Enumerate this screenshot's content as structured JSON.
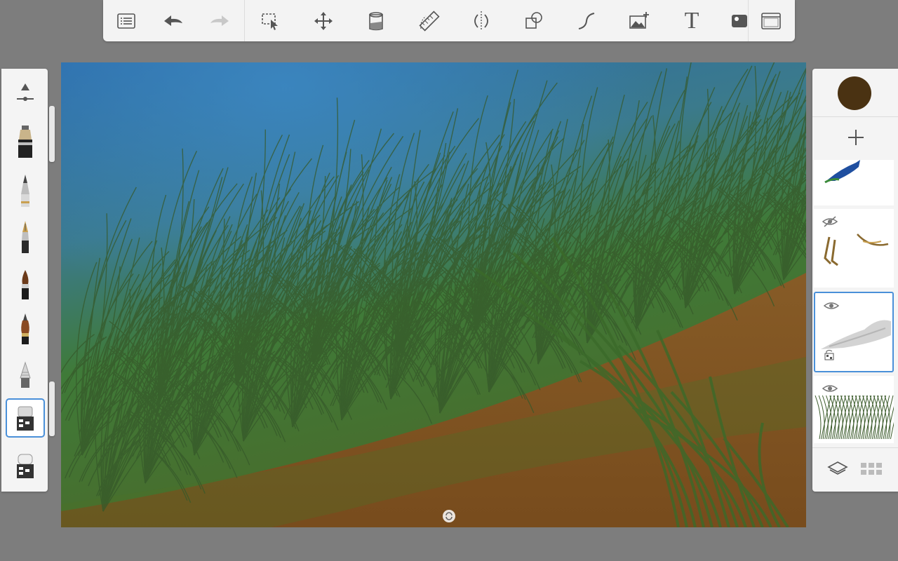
{
  "app": {
    "toolbar": {
      "tools": [
        {
          "name": "layers-menu",
          "icon": "list-icon"
        },
        {
          "name": "undo",
          "icon": "undo-icon"
        },
        {
          "name": "redo",
          "icon": "redo-icon"
        },
        {
          "name": "selection",
          "icon": "selection-icon"
        },
        {
          "name": "transform",
          "icon": "move-icon"
        },
        {
          "name": "fill",
          "icon": "bucket-icon"
        },
        {
          "name": "ruler",
          "icon": "ruler-icon"
        },
        {
          "name": "symmetry",
          "icon": "symmetry-icon"
        },
        {
          "name": "shapes",
          "icon": "shapes-icon"
        },
        {
          "name": "curve",
          "icon": "curve-icon"
        },
        {
          "name": "add-image",
          "icon": "image-add-icon"
        },
        {
          "name": "text",
          "icon": "text-icon",
          "label": "T"
        },
        {
          "name": "color-picker",
          "icon": "puck-icon"
        },
        {
          "name": "fullscreen",
          "icon": "fullscreen-icon"
        }
      ]
    },
    "brushes": [
      {
        "name": "brush-properties",
        "icon": "brush-size-icon"
      },
      {
        "name": "marker",
        "icon": "marker-icon"
      },
      {
        "name": "pencil",
        "icon": "pencil-icon"
      },
      {
        "name": "ink-pen",
        "icon": "ink-pen-icon"
      },
      {
        "name": "paint-brush",
        "icon": "paintbrush-icon"
      },
      {
        "name": "airbrush",
        "icon": "airbrush-icon"
      },
      {
        "name": "chisel-pencil",
        "icon": "chisel-icon"
      },
      {
        "name": "eraser-hard",
        "icon": "eraser-icon",
        "active": true
      },
      {
        "name": "eraser-soft",
        "icon": "eraser-soft-icon"
      }
    ],
    "layers": {
      "current_color": "#4a3212",
      "items": [
        {
          "name": "layer-bird",
          "visible": true,
          "active": false
        },
        {
          "name": "layer-sketch",
          "visible": false,
          "active": false
        },
        {
          "name": "layer-cloud",
          "visible": true,
          "active": true,
          "locked": true
        },
        {
          "name": "layer-grass",
          "visible": true,
          "active": false
        }
      ]
    },
    "colors": {
      "accent": "#4a90d9",
      "toolbar_bg": "#f3f3f3",
      "workspace_bg": "#7d7d7d",
      "sky_blue": "#2c6ea8",
      "grass_green": "#3d6a2a",
      "ground_brown": "#8a5a24"
    }
  }
}
